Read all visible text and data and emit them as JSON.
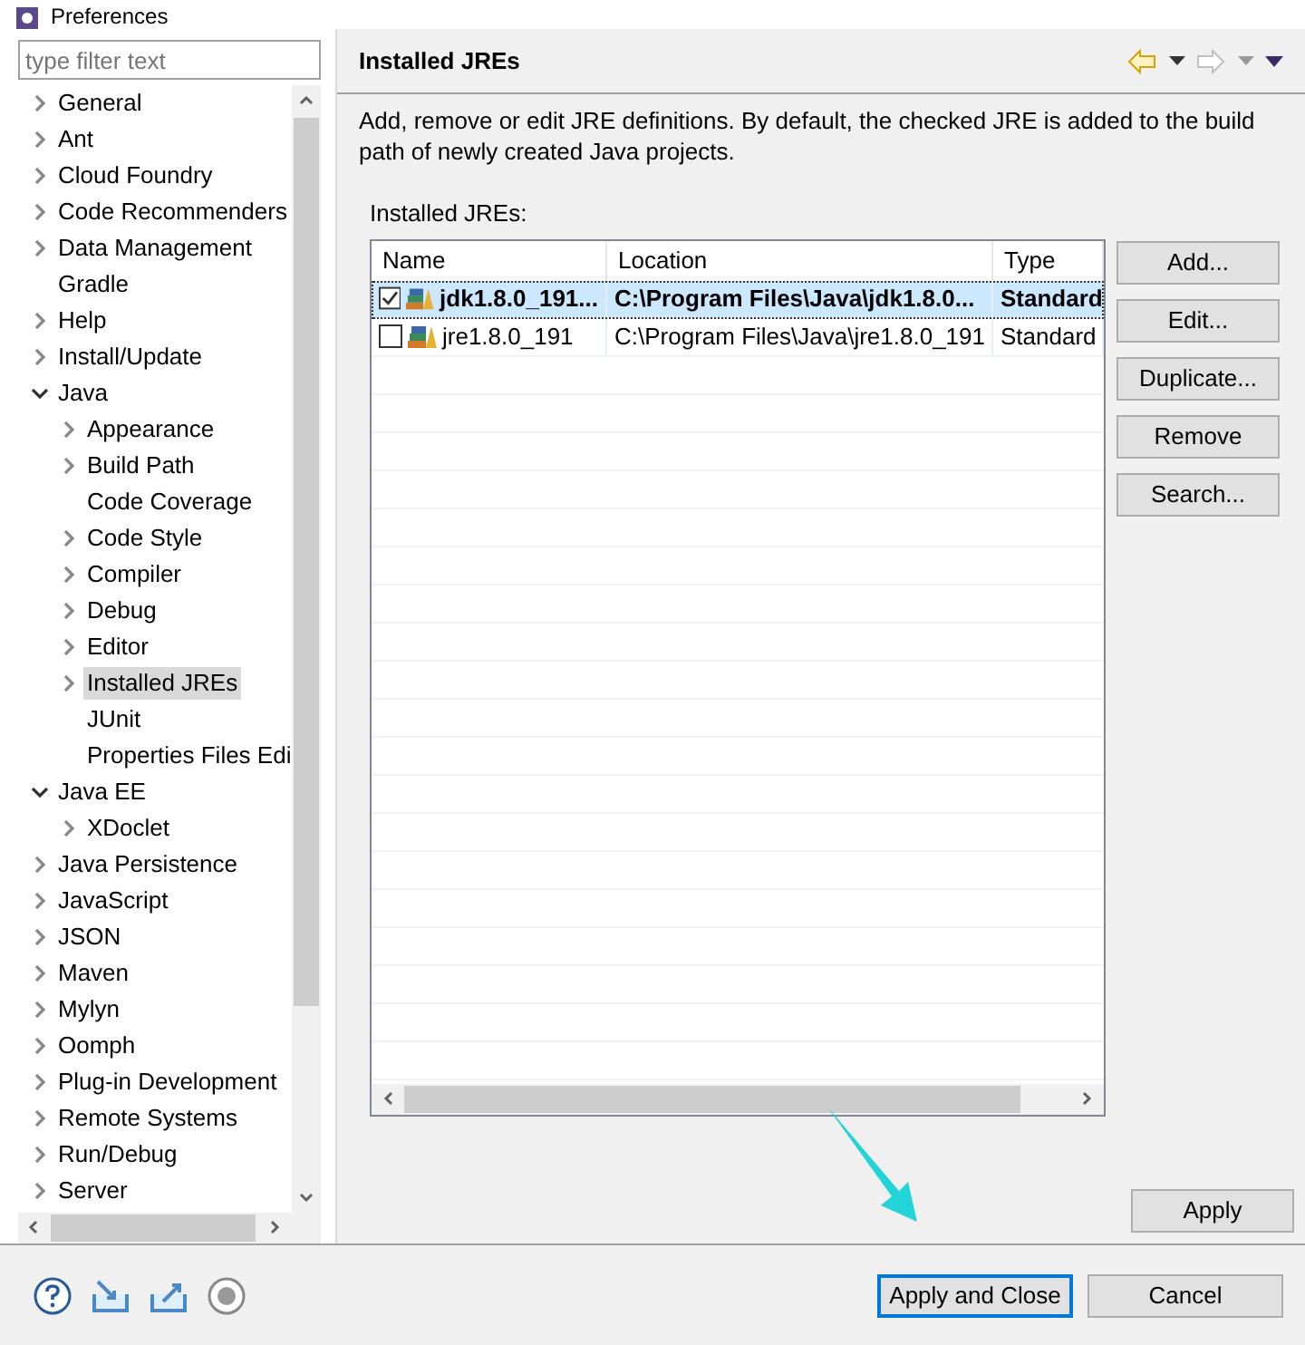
{
  "window": {
    "title": "Preferences"
  },
  "filter": {
    "placeholder": "type filter text"
  },
  "tree": [
    {
      "label": "General",
      "expanded": false,
      "selected": false
    },
    {
      "label": "Ant",
      "expanded": false,
      "selected": false
    },
    {
      "label": "Cloud Foundry",
      "expanded": false,
      "selected": false
    },
    {
      "label": "Code Recommenders",
      "expanded": false,
      "selected": false
    },
    {
      "label": "Data Management",
      "expanded": false,
      "selected": false
    },
    {
      "label": "Gradle",
      "selected": false
    },
    {
      "label": "Help",
      "expanded": false,
      "selected": false
    },
    {
      "label": "Install/Update",
      "expanded": false,
      "selected": false
    },
    {
      "label": "Java",
      "expanded": true,
      "selected": false,
      "children": [
        {
          "label": "Appearance",
          "expanded": false,
          "selected": false
        },
        {
          "label": "Build Path",
          "expanded": false,
          "selected": false
        },
        {
          "label": "Code Coverage",
          "selected": false
        },
        {
          "label": "Code Style",
          "expanded": false,
          "selected": false
        },
        {
          "label": "Compiler",
          "expanded": false,
          "selected": false
        },
        {
          "label": "Debug",
          "expanded": false,
          "selected": false
        },
        {
          "label": "Editor",
          "expanded": false,
          "selected": false
        },
        {
          "label": "Installed JREs",
          "expanded": false,
          "selected": true
        },
        {
          "label": "JUnit",
          "selected": false
        },
        {
          "label": "Properties Files Edi",
          "selected": false
        }
      ]
    },
    {
      "label": "Java EE",
      "expanded": true,
      "selected": false,
      "children": [
        {
          "label": "XDoclet",
          "expanded": false,
          "selected": false
        }
      ]
    },
    {
      "label": "Java Persistence",
      "expanded": false,
      "selected": false
    },
    {
      "label": "JavaScript",
      "expanded": false,
      "selected": false
    },
    {
      "label": "JSON",
      "expanded": false,
      "selected": false
    },
    {
      "label": "Maven",
      "expanded": false,
      "selected": false
    },
    {
      "label": "Mylyn",
      "expanded": false,
      "selected": false
    },
    {
      "label": "Oomph",
      "expanded": false,
      "selected": false
    },
    {
      "label": "Plug-in Development",
      "expanded": false,
      "selected": false
    },
    {
      "label": "Remote Systems",
      "expanded": false,
      "selected": false
    },
    {
      "label": "Run/Debug",
      "expanded": false,
      "selected": false
    },
    {
      "label": "Server",
      "expanded": false,
      "selected": false
    }
  ],
  "page": {
    "title": "Installed JREs",
    "description": "Add, remove or edit JRE definitions. By default, the checked JRE is added to the build path of newly created Java projects.",
    "table_label": "Installed JREs:",
    "table": {
      "columns": [
        "Name",
        "Location",
        "Type"
      ],
      "rows": [
        {
          "checked": true,
          "selected": true,
          "cells": [
            "jdk1.8.0_191...",
            "C:\\Program Files\\Java\\jdk1.8.0...",
            "Standard"
          ]
        },
        {
          "checked": false,
          "selected": false,
          "cells": [
            "jre1.8.0_191",
            "C:\\Program Files\\Java\\jre1.8.0_191",
            "Standard"
          ]
        }
      ]
    },
    "side_buttons": [
      "Add...",
      "Edit...",
      "Duplicate...",
      "Remove",
      "Search..."
    ],
    "apply_button": "Apply"
  },
  "footer_buttons": [
    {
      "label": "Apply and Close",
      "default": true
    },
    {
      "label": "Cancel",
      "default": false
    }
  ]
}
